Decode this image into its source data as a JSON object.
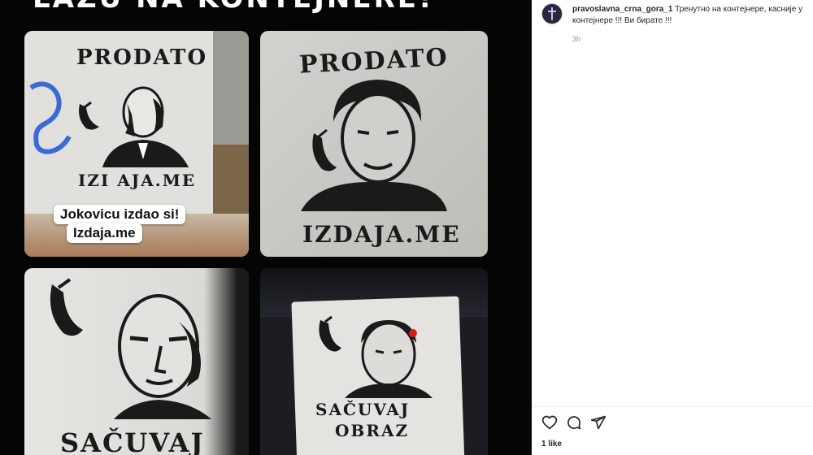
{
  "post": {
    "banner_text": "LAŽU NA KONTEJNERE!",
    "username": "pravoslavna_crna_gora_1",
    "caption": " Тренутно на контејнере, касније у контејнере !!! Ви бирате !!!",
    "time": "3h",
    "likes": "1 like"
  },
  "photos": [
    {
      "top_text": "PRODATO",
      "bottom_text": "IZI AJA.ME",
      "overlay_line1": "Jokovicu izdao si!",
      "overlay_line2": "Izdaja.me"
    },
    {
      "top_text": "PRODATO",
      "bottom_text": "IZDAJA.ME"
    },
    {
      "bottom_text": "SAČUVAJ"
    },
    {
      "bottom_line1": "SAČUVAJ",
      "bottom_line2": "OBRAZ"
    }
  ],
  "icons": {
    "like": "heart-icon",
    "comment": "comment-icon",
    "share": "send-icon"
  },
  "colors": {
    "media_bg": "#050505",
    "text": "#262626",
    "muted": "#8e8e8e"
  }
}
